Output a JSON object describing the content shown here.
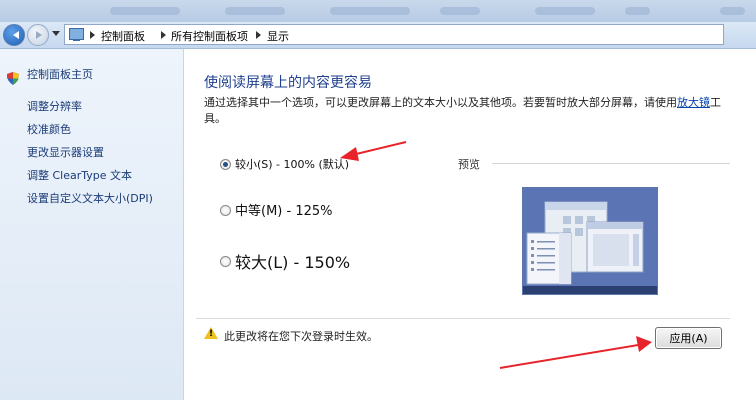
{
  "breadcrumb": {
    "items": [
      "控制面板",
      "所有控制面板项",
      "显示"
    ]
  },
  "sidebar": {
    "items": [
      {
        "label": "控制面板主页",
        "icon": ""
      },
      {
        "label": "调整分辨率",
        "icon": ""
      },
      {
        "label": "校准颜色",
        "icon": "shield-icon"
      },
      {
        "label": "更改显示器设置",
        "icon": ""
      },
      {
        "label": "调整 ClearType 文本",
        "icon": ""
      },
      {
        "label": "设置自定义文本大小(DPI)",
        "icon": ""
      }
    ]
  },
  "main": {
    "heading": "使阅读屏幕上的内容更容易",
    "description": "通过选择其中一个选项，可以更改屏幕上的文本大小以及其他项。若要暂时放大部分屏幕，请使用",
    "magnifier_link": "放大镜",
    "description_end": "工具。",
    "options": [
      {
        "label": "较小(S) - 100% (默认)",
        "selected": true
      },
      {
        "label": "中等(M) - 125%",
        "selected": false
      },
      {
        "label": "较大(L) - 150%",
        "selected": false
      }
    ],
    "preview_label": "预览",
    "notice": "此更改将在您下次登录时生效。",
    "apply_label": "应用(A)"
  },
  "colors": {
    "heading": "#1f3f8f",
    "sidebar_link": "#1a3b77",
    "annotation_arrow": "#e8232a"
  }
}
